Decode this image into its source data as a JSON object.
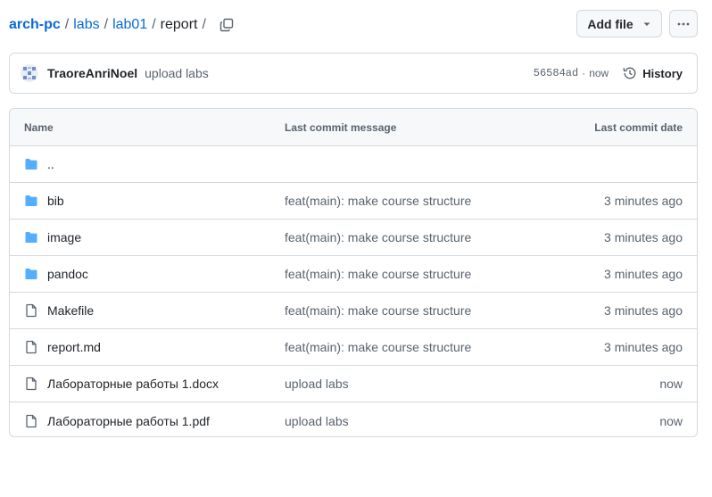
{
  "breadcrumb": {
    "root": "arch-pc",
    "separator": "/",
    "parts": [
      "labs",
      "lab01"
    ],
    "current": "report"
  },
  "toolbar": {
    "add_file_label": "Add file",
    "more_label": "..."
  },
  "commit": {
    "author": "TraoreAnriNoel",
    "message": "upload labs",
    "sha": "56584ad",
    "dot": "·",
    "time": "now",
    "history_label": "History"
  },
  "table": {
    "headers": {
      "name": "Name",
      "message": "Last commit message",
      "date": "Last commit date"
    },
    "parent_dir": "..",
    "rows": [
      {
        "name": "bib",
        "type": "folder",
        "message": "feat(main): make course structure",
        "date": "3 minutes ago"
      },
      {
        "name": "image",
        "type": "folder",
        "message": "feat(main): make course structure",
        "date": "3 minutes ago"
      },
      {
        "name": "pandoc",
        "type": "folder",
        "message": "feat(main): make course structure",
        "date": "3 minutes ago"
      },
      {
        "name": "Makefile",
        "type": "file",
        "message": "feat(main): make course structure",
        "date": "3 minutes ago"
      },
      {
        "name": "report.md",
        "type": "file",
        "message": "feat(main): make course structure",
        "date": "3 minutes ago"
      },
      {
        "name": "Лабораторные работы 1.docx",
        "type": "file",
        "message": "upload labs",
        "date": "now"
      },
      {
        "name": "Лабораторные работы 1.pdf",
        "type": "file",
        "message": "upload labs",
        "date": "now"
      }
    ]
  },
  "colors": {
    "link": "#0969da",
    "folder": "#54aeff",
    "muted": "#59636e",
    "border": "#d1d9e0"
  }
}
